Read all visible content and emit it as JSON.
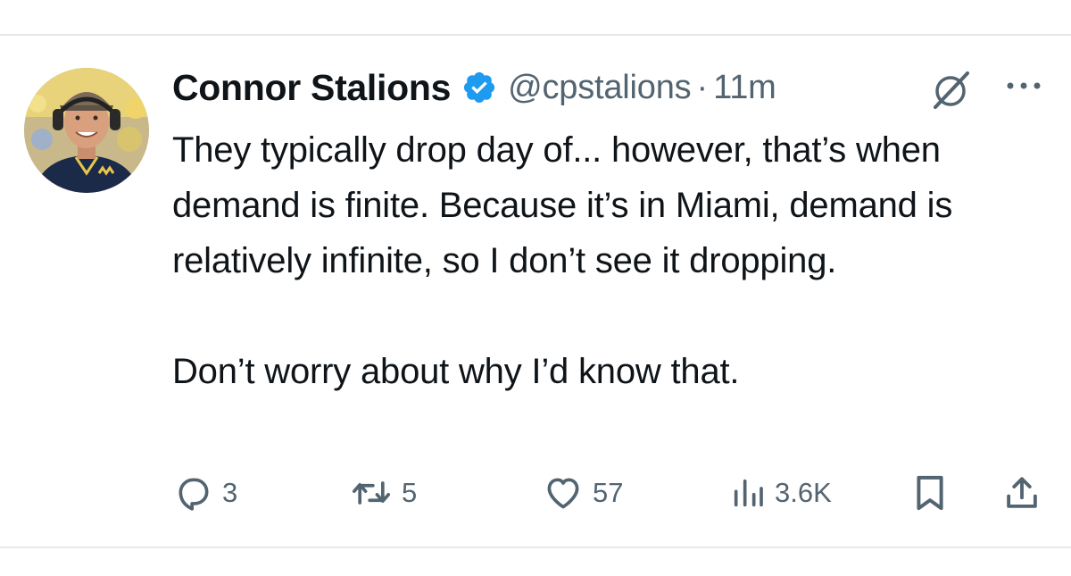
{
  "tweet": {
    "author_name": "Connor Stalions",
    "handle": "@cpstalions",
    "separator": "·",
    "time": "11m",
    "verified": true,
    "paragraphs": [
      "They typically drop day of... however, that’s when demand is finite. Because it’s in Miami, demand is relatively infinite, so I don’t see it dropping.",
      "Don’t worry about why I’d know that."
    ]
  },
  "actions": {
    "replies": "3",
    "reposts": "5",
    "likes": "57",
    "views": "3.6K"
  },
  "icons": {
    "verified": "verified-badge-icon",
    "grok": "grok-icon",
    "more": "more-icon",
    "reply": "reply-icon",
    "repost": "repost-icon",
    "like": "like-icon",
    "views": "views-icon",
    "bookmark": "bookmark-icon",
    "share": "share-icon"
  },
  "colors": {
    "text": "#0f1419",
    "secondary": "#536471",
    "verified_blue": "#1d9bf0",
    "divider": "#e6e9ec"
  }
}
